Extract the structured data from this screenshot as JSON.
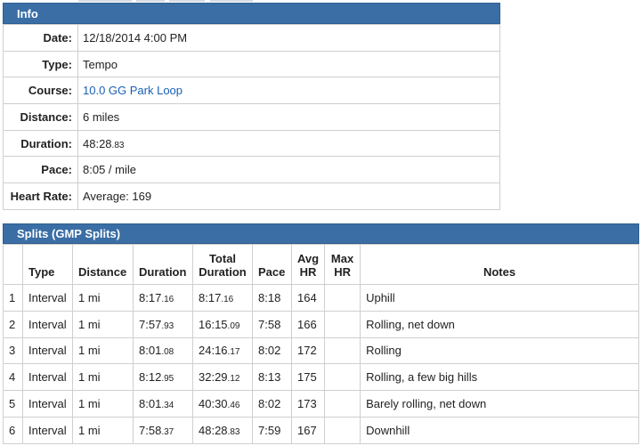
{
  "info": {
    "title": "Info",
    "rows": [
      {
        "label": "Date:",
        "value": "12/18/2014 4:00 PM"
      },
      {
        "label": "Type:",
        "value": "Tempo"
      },
      {
        "label": "Course:",
        "value": "10.0 GG Park Loop",
        "link": true
      },
      {
        "label": "Distance:",
        "value": "6 miles"
      },
      {
        "label": "Duration:",
        "value_main": "48:28",
        "value_small": ".83"
      },
      {
        "label": "Pace:",
        "value": "8:05 / mile"
      },
      {
        "label": "Heart Rate:",
        "value": "Average: 169"
      }
    ]
  },
  "splits": {
    "title": "Splits (GMP Splits)",
    "headers": {
      "type": "Type",
      "distance": "Distance",
      "duration": "Duration",
      "total_duration_line1": "Total",
      "total_duration_line2": "Duration",
      "pace": "Pace",
      "avg_hr_line1": "Avg",
      "avg_hr_line2": "HR",
      "max_hr_line1": "Max",
      "max_hr_line2": "HR",
      "notes": "Notes"
    },
    "rows": [
      {
        "num": "1",
        "type": "Interval",
        "distance": "1 mi",
        "dur_main": "8:17",
        "dur_small": ".16",
        "tot_main": "8:17",
        "tot_small": ".16",
        "pace": "8:18",
        "avg_hr": "164",
        "max_hr": "",
        "notes": "Uphill"
      },
      {
        "num": "2",
        "type": "Interval",
        "distance": "1 mi",
        "dur_main": "7:57",
        "dur_small": ".93",
        "tot_main": "16:15",
        "tot_small": ".09",
        "pace": "7:58",
        "avg_hr": "166",
        "max_hr": "",
        "notes": "Rolling, net down"
      },
      {
        "num": "3",
        "type": "Interval",
        "distance": "1 mi",
        "dur_main": "8:01",
        "dur_small": ".08",
        "tot_main": "24:16",
        "tot_small": ".17",
        "pace": "8:02",
        "avg_hr": "172",
        "max_hr": "",
        "notes": "Rolling"
      },
      {
        "num": "4",
        "type": "Interval",
        "distance": "1 mi",
        "dur_main": "8:12",
        "dur_small": ".95",
        "tot_main": "32:29",
        "tot_small": ".12",
        "pace": "8:13",
        "avg_hr": "175",
        "max_hr": "",
        "notes": "Rolling, a few big hills"
      },
      {
        "num": "5",
        "type": "Interval",
        "distance": "1 mi",
        "dur_main": "8:01",
        "dur_small": ".34",
        "tot_main": "40:30",
        "tot_small": ".46",
        "pace": "8:02",
        "avg_hr": "173",
        "max_hr": "",
        "notes": "Barely rolling, net down"
      },
      {
        "num": "6",
        "type": "Interval",
        "distance": "1 mi",
        "dur_main": "7:58",
        "dur_small": ".37",
        "tot_main": "48:28",
        "tot_small": ".83",
        "pace": "7:59",
        "avg_hr": "167",
        "max_hr": "",
        "notes": "Downhill"
      }
    ]
  },
  "colors": {
    "header_bg": "#3a6ea5",
    "link": "#1a5fb4",
    "border": "#cfcfcf"
  }
}
